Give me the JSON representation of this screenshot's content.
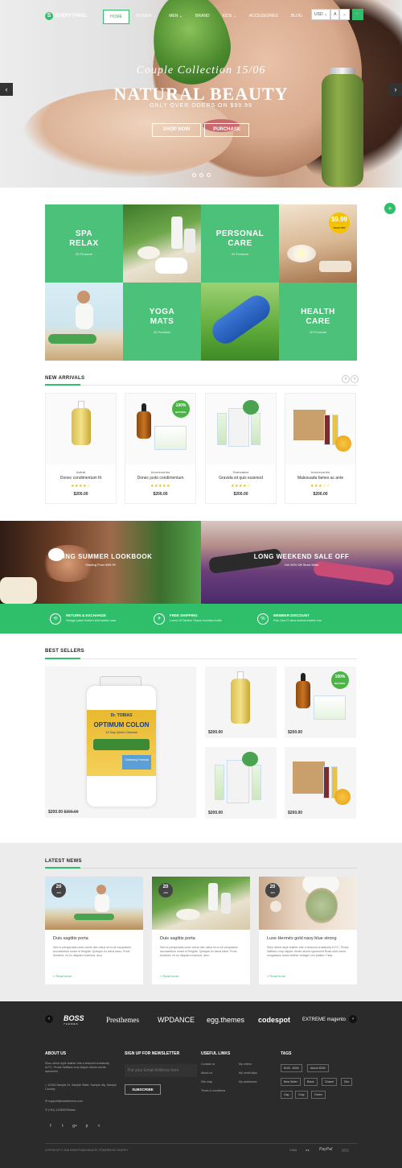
{
  "header": {
    "logo_text": "EVERYTHING",
    "nav": [
      "Home",
      "Women",
      "Men",
      "Brand",
      "Kids",
      "Accessories",
      "Blog"
    ],
    "nav_suffix": [
      "",
      "⌄",
      "⌄",
      "",
      "⌄",
      "",
      ""
    ],
    "currency": "USD ⌄",
    "lang": "A",
    "user": "⌄",
    "cart": "🛒"
  },
  "hero": {
    "subtitle": "Couple Collection 15/06",
    "title": "NATURAL BEAUTY",
    "small": "ONLY OVER ODERS ON $99.99",
    "shop_now": "SHOP NOW",
    "purchase": "PURCHASE",
    "prev": "‹",
    "next": "›"
  },
  "categories": [
    {
      "title1": "SPA",
      "title2": "RELAX",
      "count": "20 Products"
    },
    {
      "title1": "PERSONAL",
      "title2": "CARE",
      "count": "20 Products"
    },
    {
      "title1": "YOGA",
      "title2": "MATS",
      "count": "20 Products"
    },
    {
      "title1": "HEALTH",
      "title2": "CARE",
      "count": "20 Products"
    }
  ],
  "price_badge": {
    "amount": "$9.99",
    "label": "SALE OFF"
  },
  "new_arrivals": {
    "title": "NEW ARRIVALS",
    "products": [
      {
        "brand": "Antrai",
        "name": "Donec condimentum fit",
        "stars": "★★★★☆",
        "price": "$200.00"
      },
      {
        "brand": "Accessories",
        "name": "Donec justo condimentum",
        "stars": "★★★★★",
        "price": "$200.00"
      },
      {
        "brand": "Gomeador",
        "name": "Gravida sit quis euismod",
        "stars": "★★★★☆",
        "price": "$200.00"
      },
      {
        "brand": "Accessories",
        "name": "Malesuada fames ac ante",
        "stars": "★★★☆☆",
        "price": "$200.00"
      }
    ]
  },
  "badge_100": {
    "top": "100%",
    "bottom": "NATURAL"
  },
  "banners": [
    {
      "title": "SPRING SUMMER LOOKBOOK",
      "sub": "Starting From $99.99"
    },
    {
      "title": "LONG WEEKEND SALE OFF",
      "sub": "Get 30% Off Store Wide"
    }
  ],
  "services": [
    {
      "icon": "⟲",
      "title": "RETURN & EXCHANGE",
      "desc": "Vintage pastel lectus's shirt leather case"
    },
    {
      "icon": "✈",
      "title": "FREE SHIPPING",
      "desc": "Lorem 16 Tandem Thame crumbled bottle"
    },
    {
      "icon": "%",
      "title": "MEMBER DISCOUNT",
      "desc": "Fido Cara D' dena keetvan leather hoe"
    }
  ],
  "best_sellers": {
    "title": "BEST SELLERS",
    "featured_price": "$200.00",
    "featured_old": "$300.00",
    "prices": [
      "$200.00",
      "$200.00",
      "$200.00",
      "$200.00"
    ],
    "featured_product": {
      "brand": "Dr. TOBIAS",
      "name": "OPTIMUM COLON",
      "sub": "14 Day Quick Cleanse",
      "label": "Cleansing Formula"
    }
  },
  "latest_news": {
    "title": "LATEST NEWS",
    "posts": [
      {
        "day": "20",
        "month": "JAN",
        "title": "Duis sagittis porta",
        "desc": "Sed ut perspiciatis unde omnis iste natus error sit voluptatem accusantium unaut ut fringilla. Quisque eu lacus eaus. Proin tincidunt, mi ex aliquam euismod, arcu.",
        "more": "Read more"
      },
      {
        "day": "20",
        "month": "JAN",
        "title": "Duis sagittis porta",
        "desc": "Sed ut perspiciatis unde omnis iste natus error sit voluptatem accusantium unaut ut fringilla. Quisque eu lacus eaus. Proin tincidunt, mi ex aliquam euismod, arcu.",
        "more": "Read more"
      },
      {
        "day": "20",
        "month": "JAN",
        "title": "Luxe Hermès gold navy blue strong",
        "desc": "Shun street style leather tote a textured crossbody A.P.C. Proda Saffiano crop slipper denim shorts spearmint Braid skirt round sunglasses seam leather vintage Levi plaited. Flats.",
        "more": "Read more"
      }
    ]
  },
  "brands": [
    "BOSS",
    "Presthemes",
    "WPDANCE",
    "egg.themes",
    "codespot",
    "EXTREME magento"
  ],
  "boss_sub": "THEMES",
  "footer": {
    "about_title": "ABOUT US",
    "about_text": "Shun street style leather tote a textured crossbody A.P.C. Proda Saffiano crop slipper denim shorts spearmint",
    "address": "12345 Sample Dr, Sample State, Sample city, Sample Country",
    "email": "support@bossthemes.com",
    "phone": "(+91) 123456789aaa",
    "social": [
      "f",
      "t",
      "g+",
      "p",
      "<"
    ],
    "newsletter_title": "SIGN UP FOR NEWSLETTER",
    "newsletter_placeholder": "Put your Email Address here",
    "subscribe": "SUBSCRIBE",
    "links_title": "USEFUL LINKS",
    "links_col1": [
      "Contact us",
      "About us",
      "Site map",
      "Terms & conditions"
    ],
    "links_col2": [
      "My orders",
      "My credit slips",
      "My addresses"
    ],
    "tags_title": "TAGS",
    "tags": [
      "$100 - $200",
      "Above $200",
      "Best Seller",
      "Black",
      "Chanel",
      "Dior",
      "Gap",
      "Gray",
      "Green"
    ],
    "copyright": "COPYRIGHT © 2016 EVERYTHING BEAUTE. POWERED BY SHOPIFY",
    "payments": [
      "VISA",
      "●●",
      "PayPal",
      "▯▯▯▯"
    ]
  }
}
